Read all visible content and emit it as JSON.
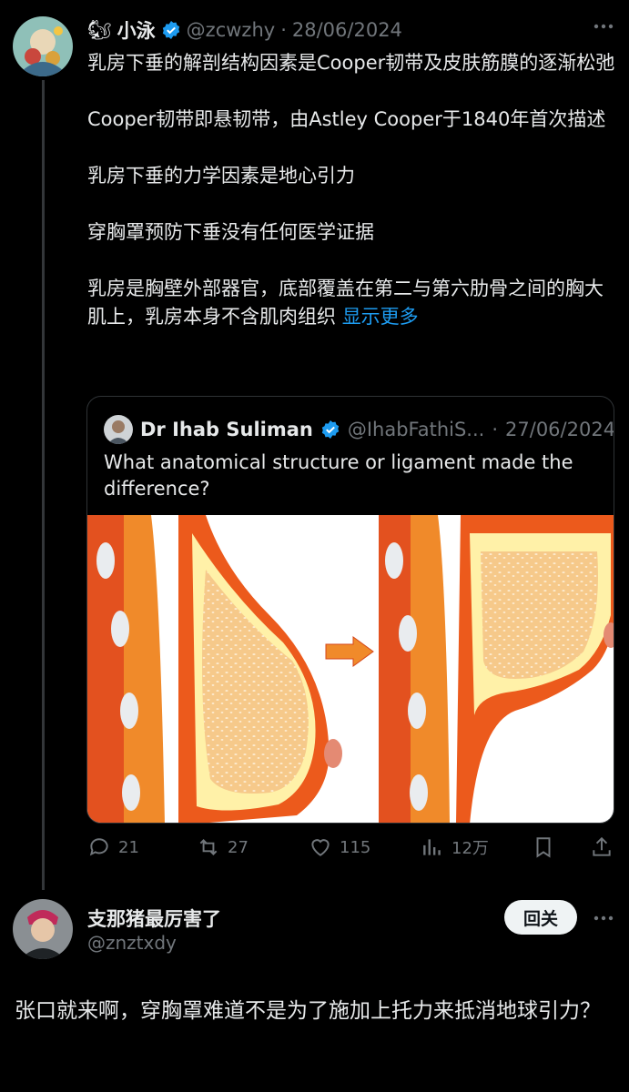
{
  "tweet": {
    "author_name": "小泳",
    "author_emoji": "🐿",
    "handle": "@zcwzhy",
    "dot": "·",
    "date": "28/06/2024",
    "paragraphs": [
      "乳房下垂的解剖结构因素是Cooper韧带及皮肤筋膜的逐渐松弛",
      "Cooper韧带即悬韧带，由Astley Cooper于1840年首次描述",
      "乳房下垂的力学因素是地心引力",
      "穿胸罩预防下垂没有任何医学证据"
    ],
    "last_paragraph": "乳房是胸壁外部器官，底部覆盖在第二与第六肋骨之间的胸大肌上，乳房本身不含肌肉组织",
    "show_more": "显示更多",
    "quote": {
      "author_name": "Dr Ihab Suliman",
      "handle": "@IhabFathiS...",
      "dot": "·",
      "date": "27/06/2024",
      "text": "What anatomical structure or ligament made the difference?"
    },
    "actions": {
      "replies": "21",
      "retweets": "27",
      "likes": "115",
      "views": "12万"
    }
  },
  "reply": {
    "author_name": "支那猪最厉害了",
    "handle": "@znztxdy",
    "follow_label": "回关",
    "text": "张口就来啊，穿胸罩难道不是为了施加上托力来抵消地球引力？"
  },
  "colors": {
    "background": "#000000",
    "text": "#e7e9ea",
    "muted": "#71767b",
    "link": "#1d9bf0",
    "verified": "#1d9bf0"
  }
}
